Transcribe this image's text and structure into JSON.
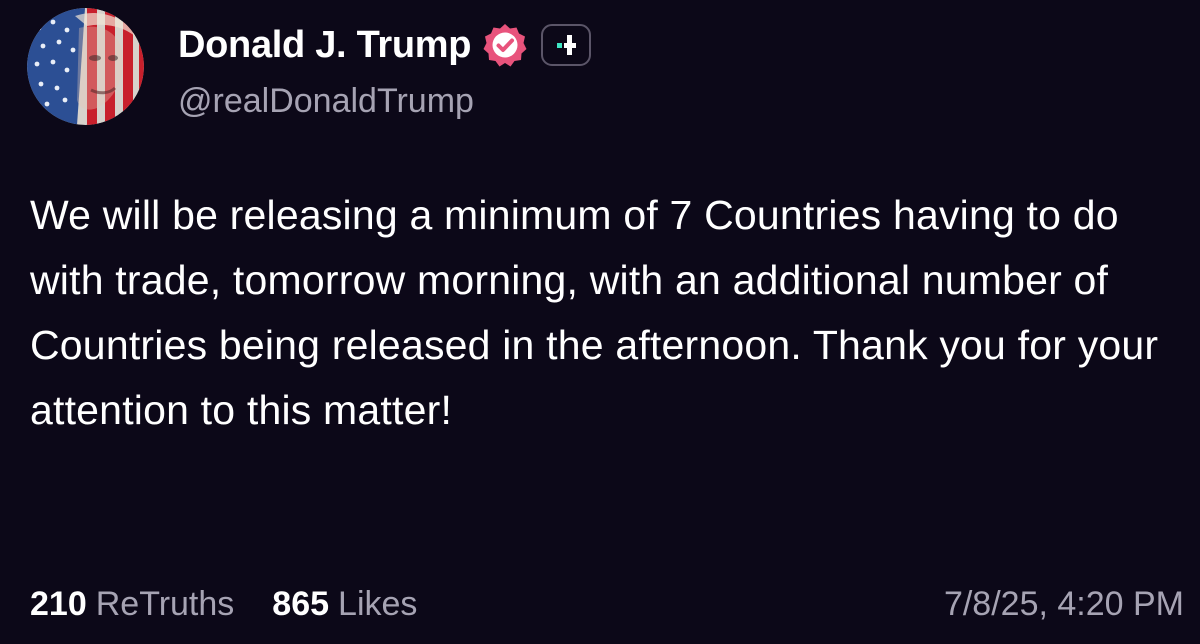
{
  "author": {
    "display_name": "Donald J. Trump",
    "handle": "@realDonaldTrump",
    "avatar_icon": "flag-face-avatar",
    "verified_icon": "verified-badge-icon",
    "follow_icon": "plus-icon"
  },
  "post": {
    "text": "We will be releasing a minimum of 7 Countries having to do with trade, tomorrow morning, with an additional number of Countries being released in the afternoon. Thank you for your attention to this matter!",
    "retruths_count": "210",
    "retruths_label": "ReTruths",
    "likes_count": "865",
    "likes_label": "Likes",
    "timestamp": "7/8/25, 4:20 PM"
  },
  "colors": {
    "background": "#0c0818",
    "text_primary": "#ffffff",
    "text_secondary": "#a6a3b3",
    "verified_badge": "#e8537c",
    "follow_accent": "#3ee6c4"
  }
}
